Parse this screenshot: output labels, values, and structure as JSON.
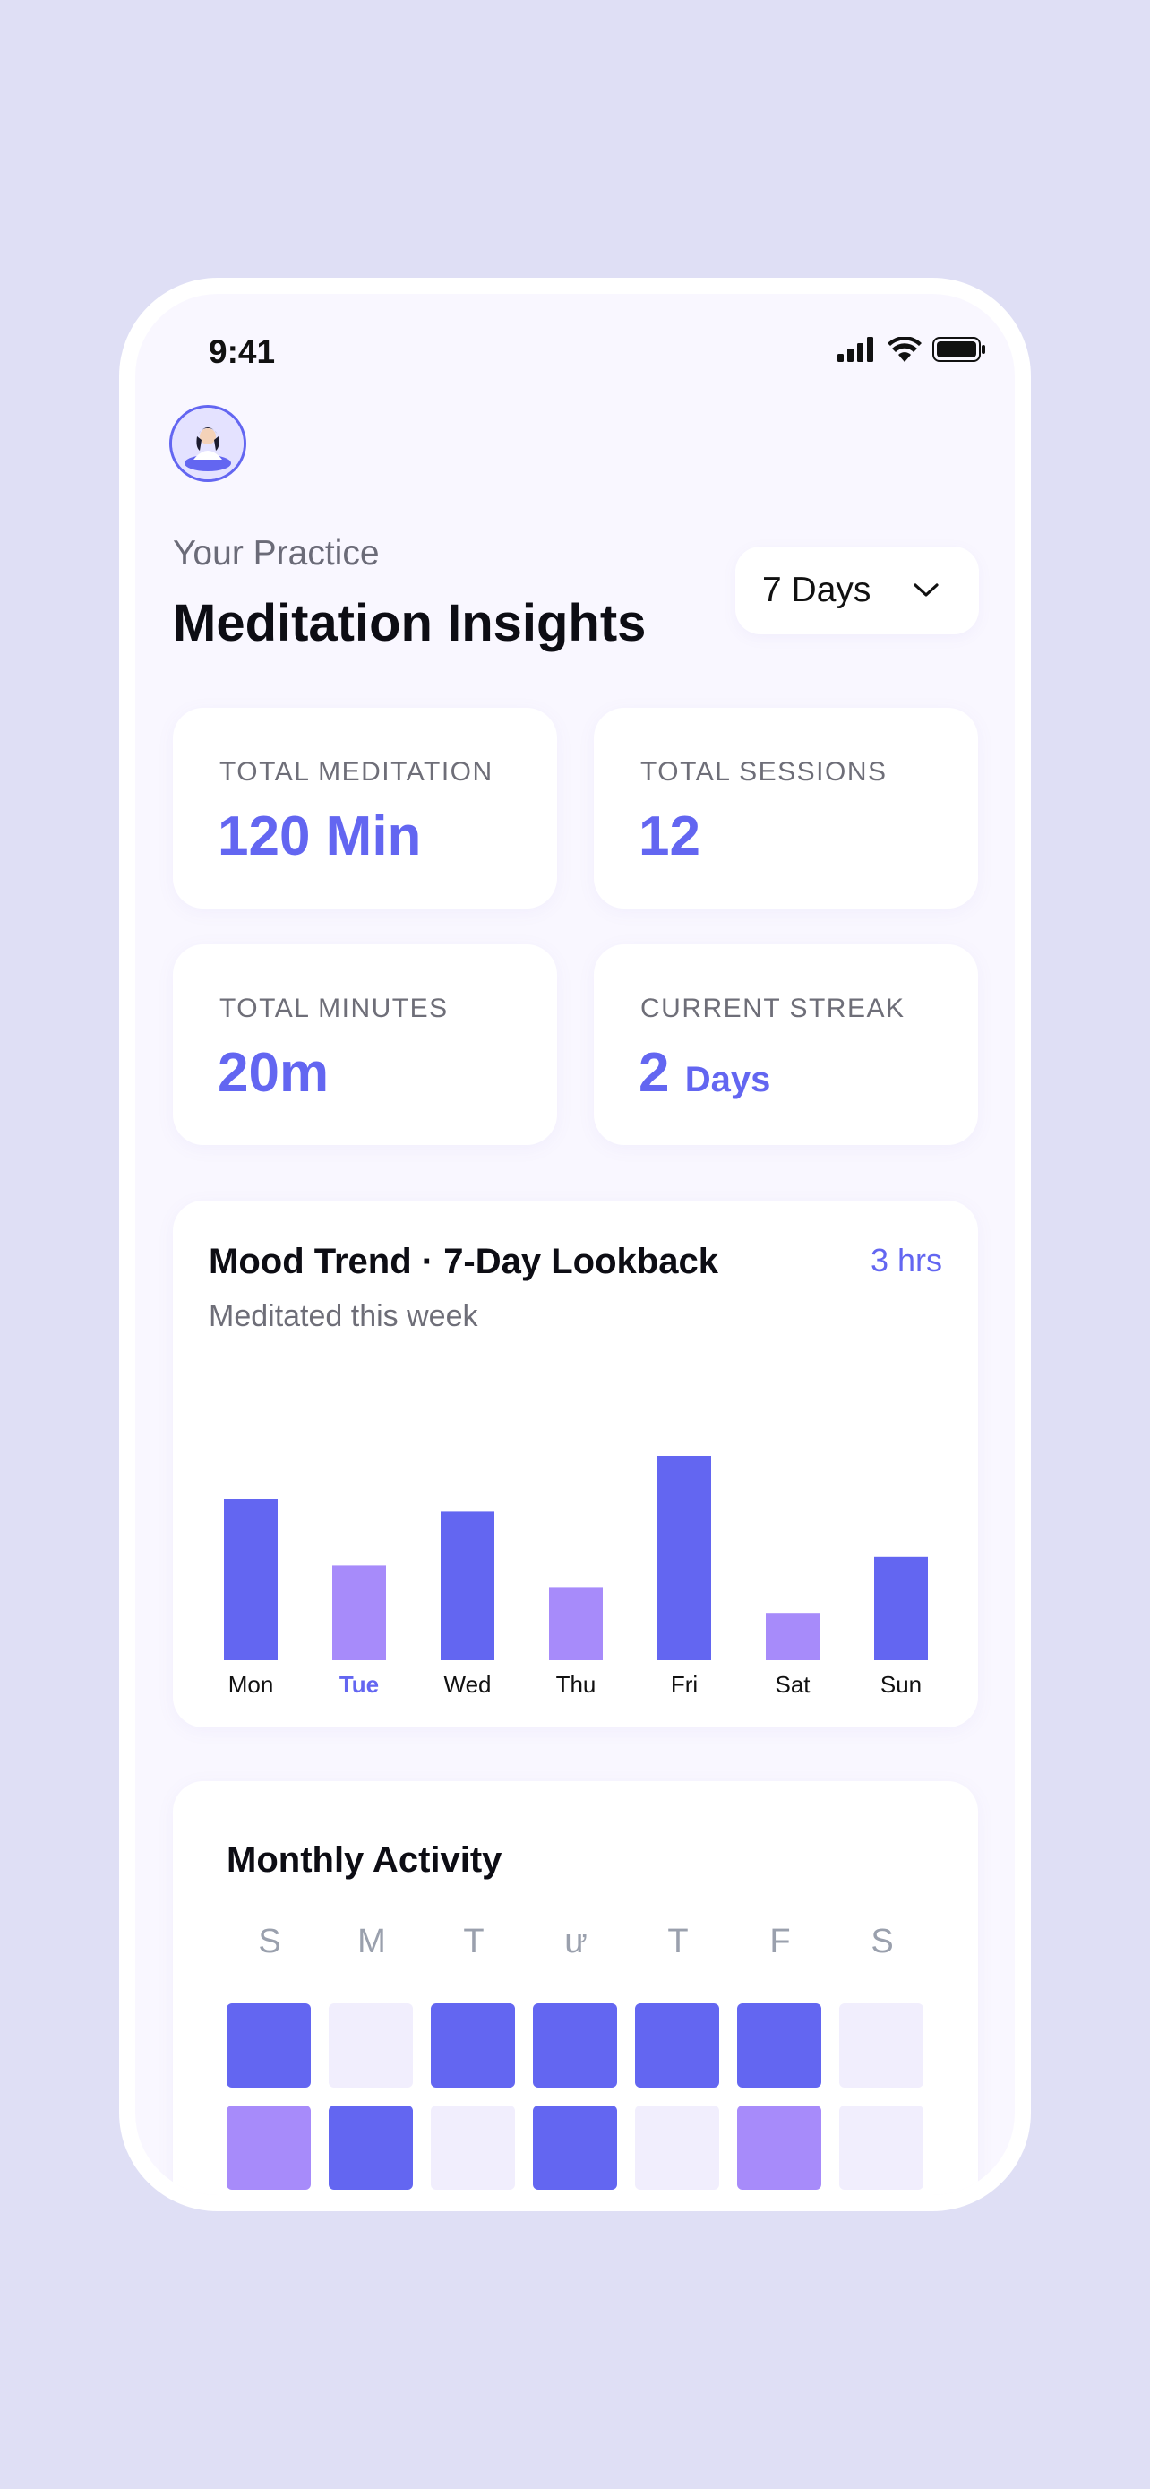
{
  "status": {
    "time": "9:41"
  },
  "header": {
    "subtitle": "Your Practice",
    "title": "Meditation Insights",
    "range": "7 Days"
  },
  "stats": [
    {
      "label": "TOTAL MEDITATION",
      "value": "120 Min",
      "unit": ""
    },
    {
      "label": "TOTAL SESSIONS",
      "value": "12",
      "unit": ""
    },
    {
      "label": "TOTAL MINUTES",
      "value": "20m",
      "unit": ""
    },
    {
      "label": "CURRENT STREAK",
      "value": "2",
      "unit": "Days"
    }
  ],
  "mood_chart": {
    "title": "Mood Trend · 7-Day Lookback",
    "subtitle": "Meditated this week",
    "badge": "3 hrs"
  },
  "chart_data": {
    "type": "bar",
    "categories": [
      "Mon",
      "Tue",
      "Wed",
      "Thu",
      "Fri",
      "Sat",
      "Sun"
    ],
    "values": [
      75,
      44,
      69,
      34,
      95,
      22,
      48
    ],
    "ylim": [
      0,
      100
    ],
    "highlighted_category": "Tue",
    "bar_colors": [
      "#6366f1",
      "#a78bfa",
      "#6366f1",
      "#a78bfa",
      "#6366f1",
      "#a78bfa",
      "#6366f1"
    ],
    "grid": false
  },
  "monthly": {
    "title": "Monthly Activity",
    "weekdays": [
      "S",
      "M",
      "T",
      "ư",
      "T",
      "F",
      "S"
    ],
    "rows": [
      [
        "high",
        "none",
        "high",
        "high",
        "high",
        "high",
        "none"
      ],
      [
        "mid",
        "high",
        "none",
        "high",
        "none",
        "mid",
        "none"
      ]
    ]
  },
  "colors": {
    "accent": "#6366f1",
    "accent_light": "#a78bfa",
    "empty": "#f1eefd",
    "text": "#0d0d14",
    "muted": "#6e6e78"
  }
}
